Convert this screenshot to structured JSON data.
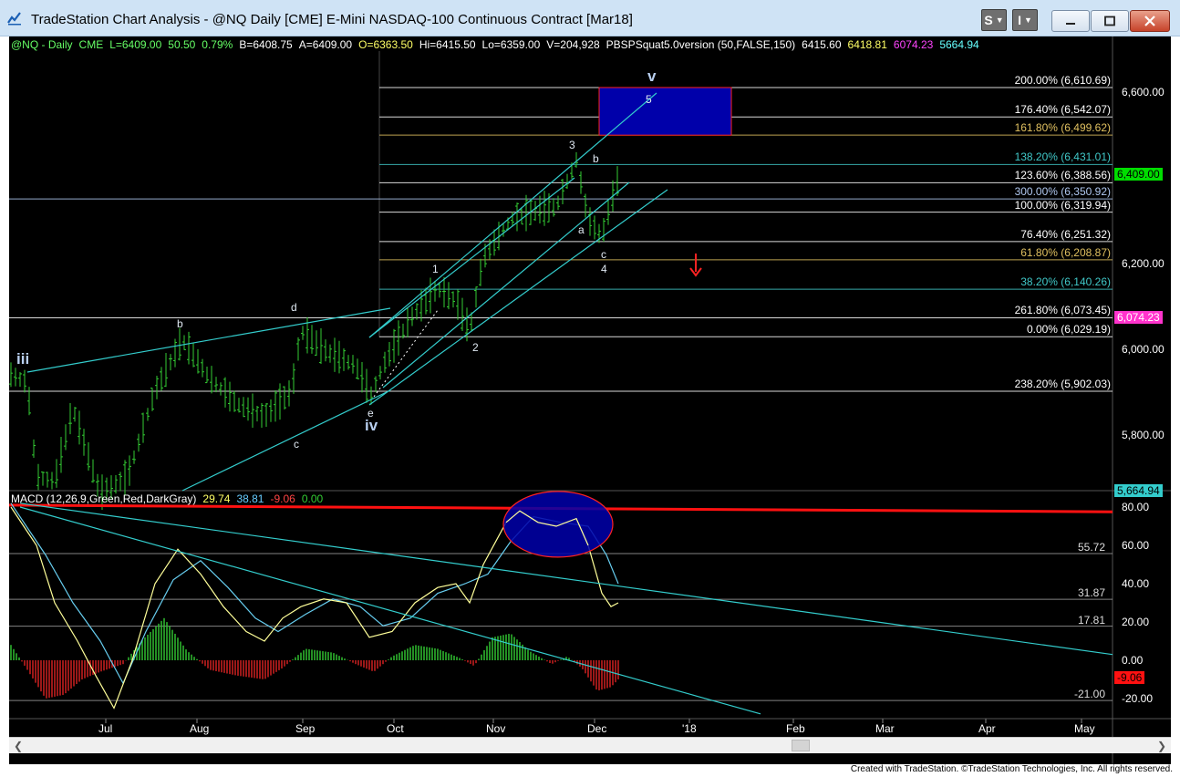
{
  "window": {
    "title": "TradeStation Chart Analysis - @NQ Daily [CME] E-Mini NASDAQ-100 Continuous Contract [Mar18]",
    "s_button": "S",
    "i_button": "I"
  },
  "header": {
    "symbol": "@NQ - Daily",
    "exchange": "CME",
    "last": "L=6409.00",
    "change": "50.50",
    "change_pct": "0.79%",
    "bid": "B=6408.75",
    "ask": "A=6409.00",
    "open": "O=6363.50",
    "high": "Hi=6415.50",
    "low": "Lo=6359.00",
    "volume": "V=204,928",
    "study": "PBSPSquat5.0version (50,FALSE,150)",
    "study_values": [
      {
        "text": "6415.60",
        "color": "#ffffff"
      },
      {
        "text": "6418.81",
        "color": "#ffff66"
      },
      {
        "text": "6074.23",
        "color": "#ff44ff"
      },
      {
        "text": "5664.94",
        "color": "#66ffff"
      }
    ]
  },
  "fib_levels": [
    {
      "label": "200.00% (6,610.69)",
      "price": 6610.69,
      "color": "#ffffff"
    },
    {
      "label": "176.40% (6,542.07)",
      "price": 6542.07,
      "color": "#ffffff"
    },
    {
      "label": "161.80% (6,499.62)",
      "price": 6499.62,
      "color": "#e0c060"
    },
    {
      "label": "138.20% (6,431.01)",
      "price": 6431.01,
      "color": "#40c8c8"
    },
    {
      "label": "123.60% (6,388.56)",
      "price": 6388.56,
      "color": "#ffffff"
    },
    {
      "label": "300.00% (6,350.92)",
      "price": 6350.92,
      "color": "#b0c8f0"
    },
    {
      "label": "100.00% (6,319.94)",
      "price": 6319.94,
      "color": "#ffffff"
    },
    {
      "label": "76.40% (6,251.32)",
      "price": 6251.32,
      "color": "#ffffff"
    },
    {
      "label": "61.80% (6,208.87)",
      "price": 6208.87,
      "color": "#e0c060"
    },
    {
      "label": "38.20% (6,140.26)",
      "price": 6140.26,
      "color": "#40c8c8"
    },
    {
      "label": "261.80% (6,073.45)",
      "price": 6073.45,
      "color": "#ffffff"
    },
    {
      "label": "0.00% (6,029.19)",
      "price": 6029.19,
      "color": "#ffffff"
    },
    {
      "label": "238.20% (5,902.03)",
      "price": 5902.03,
      "color": "#ffffff"
    }
  ],
  "wave_labels": [
    {
      "text": "iii",
      "big": true
    },
    {
      "text": "b",
      "big": false
    },
    {
      "text": "c",
      "big": false
    },
    {
      "text": "d",
      "big": false
    },
    {
      "text": "e",
      "big": false
    },
    {
      "text": "iv",
      "big": true
    },
    {
      "text": "1",
      "big": false
    },
    {
      "text": "2",
      "big": false
    },
    {
      "text": "3",
      "big": false
    },
    {
      "text": "a",
      "big": false
    },
    {
      "text": "b",
      "big": false
    },
    {
      "text": "c",
      "big": false
    },
    {
      "text": "4",
      "big": false
    },
    {
      "text": "5",
      "big": false
    },
    {
      "text": "v",
      "big": true
    }
  ],
  "price_axis": {
    "ticks": [
      "6,600.00",
      "6,200.00",
      "6,000.00",
      "5,800.00"
    ],
    "last_price_box": "6,409.00",
    "last_price_color": "#00dd00",
    "ma_box": "6,074.23",
    "ma_color": "#ff33cc",
    "low_box": "5,664.94",
    "low_color": "#33cccc"
  },
  "macd": {
    "title": "MACD (12,26,9,Green,Red,DarkGray)",
    "macd_value": "29.74",
    "signal_value": "38.81",
    "diff_value": "-9.06",
    "zero_value": "0.00",
    "ticks": [
      "80.00",
      "60.00",
      "40.00",
      "20.00",
      "0.00",
      "-20.00"
    ],
    "levels": [
      {
        "label": "55.72",
        "value": 55.72
      },
      {
        "label": "31.87",
        "value": 31.87
      },
      {
        "label": "17.81",
        "value": 17.81
      },
      {
        "label": "-21.00",
        "value": -21.0
      }
    ],
    "diff_box": "-9.06"
  },
  "time_axis": [
    "Jul",
    "Aug",
    "Sep",
    "Oct",
    "Nov",
    "Dec",
    "'18",
    "Feb",
    "Mar",
    "Apr",
    "May"
  ],
  "footer": "Created with TradeStation. ©TradeStation Technologies, Inc. All rights reserved.",
  "colors": {
    "bars": "#33cc33",
    "trendline": "#33cccc",
    "macd_line": "#ffff99",
    "signal_line": "#66ccee",
    "hist_up": "#33cc33",
    "hist_down": "#dd2222",
    "resistance": "#ff1111",
    "target_box": "#0000aa"
  },
  "chart_data": {
    "type": "bar",
    "title": "@NQ Daily [CME] E-Mini NASDAQ-100 Continuous Contract [Mar18]",
    "x_labels": [
      "Jul",
      "Aug",
      "Sep",
      "Oct",
      "Nov",
      "Dec",
      "'18",
      "Feb",
      "Mar",
      "Apr",
      "May"
    ],
    "ylim": [
      5650,
      6670
    ],
    "price_ticks": [
      6600,
      6200,
      6000,
      5800
    ],
    "last_close": 6409.0,
    "wave_structure": [
      {
        "label": "iii",
        "price": 5920
      },
      {
        "label": "iv",
        "price": 5890
      },
      {
        "label": "1",
        "price": 6150
      },
      {
        "label": "2",
        "price": 6020
      },
      {
        "label": "3",
        "price": 6440
      },
      {
        "label": "4",
        "price": 6255
      }
    ],
    "target_zone": [
      6499.62,
      6610.69
    ],
    "macd_ylim": [
      -28,
      86
    ]
  }
}
